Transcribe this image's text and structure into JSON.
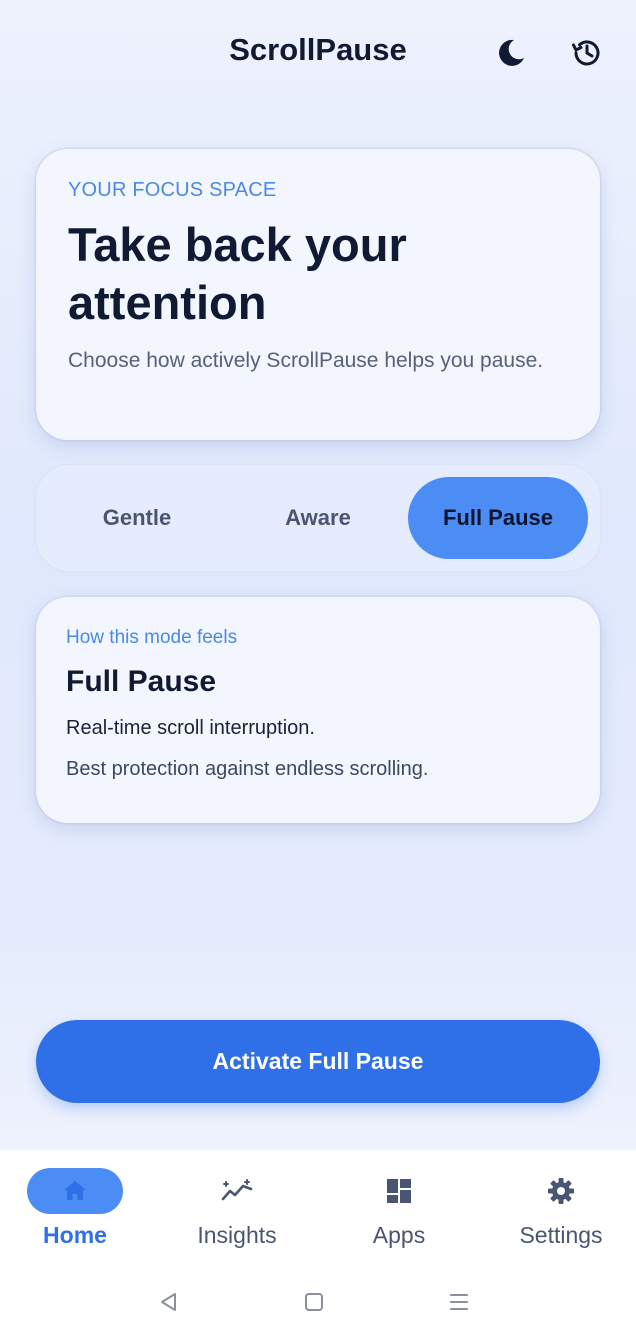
{
  "header": {
    "title": "ScrollPause",
    "icons": [
      "moon-icon",
      "history-icon"
    ]
  },
  "hero": {
    "eyebrow": "YOUR FOCUS SPACE",
    "headline_line1": "Take back your",
    "headline_line2": "attention",
    "subtitle": "Choose how actively ScrollPause helps you pause."
  },
  "modes": {
    "options": [
      "Gentle",
      "Aware",
      "Full Pause"
    ],
    "selected": "Full Pause"
  },
  "mode_card": {
    "eyebrow": "How this mode feels",
    "title": "Full Pause",
    "line1": "Real-time scroll interruption.",
    "line2": "Best protection against endless scrolling."
  },
  "cta": {
    "label": "Activate Full Pause"
  },
  "nav": {
    "items": [
      {
        "label": "Home",
        "icon": "home-icon",
        "active": true
      },
      {
        "label": "Insights",
        "icon": "insights-icon",
        "active": false
      },
      {
        "label": "Apps",
        "icon": "apps-icon",
        "active": false
      },
      {
        "label": "Settings",
        "icon": "gear-icon",
        "active": false
      }
    ]
  },
  "colors": {
    "accent": "#2f6fe8",
    "selected_segment": "#4c8df5",
    "eyebrow": "#4a8ae0",
    "text_dark": "#111a33"
  }
}
